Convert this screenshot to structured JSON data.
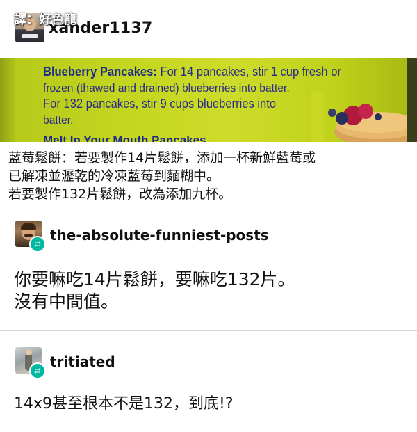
{
  "translator_tag": "譯：好色龍",
  "original_post": {
    "username": "xander1137",
    "photo_text": {
      "line1_bold": "Blueberry Pancakes:",
      "line1_rest": " For 14 pancakes, stir 1 cup fresh or",
      "line2": "frozen (thawed and drained) blueberries into batter.",
      "line3": "For 132 pancakes, stir 9 cups blueberries into",
      "line4": "batter.",
      "line5_cut": "Melt In Your Mouth Pancakes"
    },
    "caption_lines": [
      "藍莓鬆餅：若要製作14片鬆餅，添加一杯新鮮藍莓或",
      "已解凍並瀝乾的冷凍藍莓到麵糊中。",
      "若要製作132片鬆餅，改為添加九杯。"
    ]
  },
  "reblog_1": {
    "username": "the-absolute-funniest-posts",
    "body_lines": [
      "你要嘛吃14片鬆餅，要嘛吃132片。",
      "沒有中間值。"
    ]
  },
  "reblog_2": {
    "username": "tritiated",
    "body_lines": [
      "14x9甚至根本不是132，到底!?"
    ]
  },
  "icons": {
    "reblog_badge": "reblog-icon",
    "reblog_badge_color": "#00b8a0",
    "photo_text_color": "#2a2a88",
    "photo_bg_color": "#c4d61e"
  }
}
